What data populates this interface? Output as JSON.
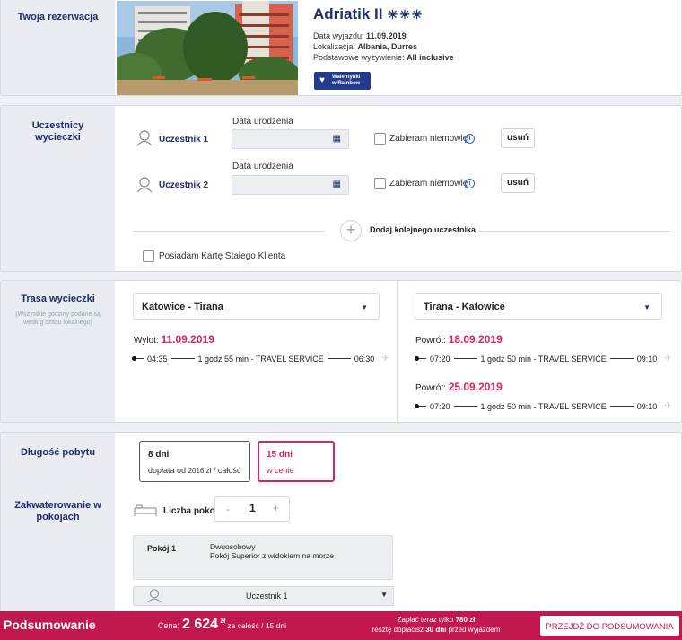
{
  "reservation": {
    "label": "Twoja rezerwacja",
    "hotel_name": "Adriatik II",
    "stars": "☀☀☀",
    "departure_label": "Data wyjazdu:",
    "departure_value": "11.09.2019",
    "location_label": "Lokalizacja:",
    "location_value": "Albania, Durres",
    "board_label": "Podstawowe wyżywienie:",
    "board_value": "All inclusive",
    "badge_line1": "Walentynki",
    "badge_line2": "w Rainbow"
  },
  "participants": {
    "label": "Uczestnicy wycieczki",
    "birth_label": "Data urodzenia",
    "rows": [
      {
        "name": "Uczestnik 1",
        "infant_label": "Zabieram niemowlę",
        "remove_label": "usuń"
      },
      {
        "name": "Uczestnik 2",
        "infant_label": "Zabieram niemowlę",
        "remove_label": "usuń"
      }
    ],
    "add_label": "Dodaj kolejnego uczestnika",
    "card_label": "Posiadam Kartę Stałego Klienta"
  },
  "route": {
    "label": "Trasa wycieczki",
    "note": "(Wszystkie godziny podane są według czasu lokalnego)",
    "outbound": {
      "select": "Katowice - Tirana",
      "date_label": "Wylot:",
      "date": "11.09.2019",
      "dep": "04:35",
      "info": "1 godz 55 min - TRAVEL SERVICE",
      "arr": "06:30"
    },
    "return": {
      "select": "Tirana - Katowice",
      "options": [
        {
          "date_label": "Powrót:",
          "date": "18.09.2019",
          "dep": "07:20",
          "info": "1 godz 50 min - TRAVEL SERVICE",
          "arr": "09:10"
        },
        {
          "date_label": "Powrót:",
          "date": "25.09.2019",
          "dep": "07:20",
          "info": "1 godz 50 min - TRAVEL SERVICE",
          "arr": "09:10"
        }
      ]
    }
  },
  "stay": {
    "label": "Długość pobytu",
    "option1_title": "8 dni",
    "option1_sub_a": "dopłata od",
    "option1_sub_amount": "2016 zł",
    "option1_sub_b": "/ całość",
    "option2_title": "15 dni",
    "option2_sub": "w cenie"
  },
  "rooms": {
    "label": "Zakwaterowanie w pokojach",
    "count_label": "Liczba pokoi",
    "count": "1",
    "minus": "-",
    "plus": "+",
    "room_name": "Pokój 1",
    "room_type": "Dwuosobowy",
    "room_desc": "Pokój Superior z widokiem na morze",
    "participant_select": "Uczestnik 1"
  },
  "summary": {
    "title": "Podsumowanie",
    "price_label": "Cena:",
    "price": "2 624",
    "currency": "zł",
    "price_note": "za całość / 15 dni",
    "pay_line1_a": "Zapłać teraz tylko",
    "pay_line1_b": "780 zł",
    "pay_line2_a": "resztę dopłacisz",
    "pay_line2_b": "30 dni",
    "pay_line2_c": "przed wyjazdem",
    "cta": "PRZEJDŹ DO PODSUMOWANIA"
  },
  "colors": {
    "navy": "#1f2d6b",
    "pink": "#d5245e",
    "bar": "#c3184f"
  }
}
